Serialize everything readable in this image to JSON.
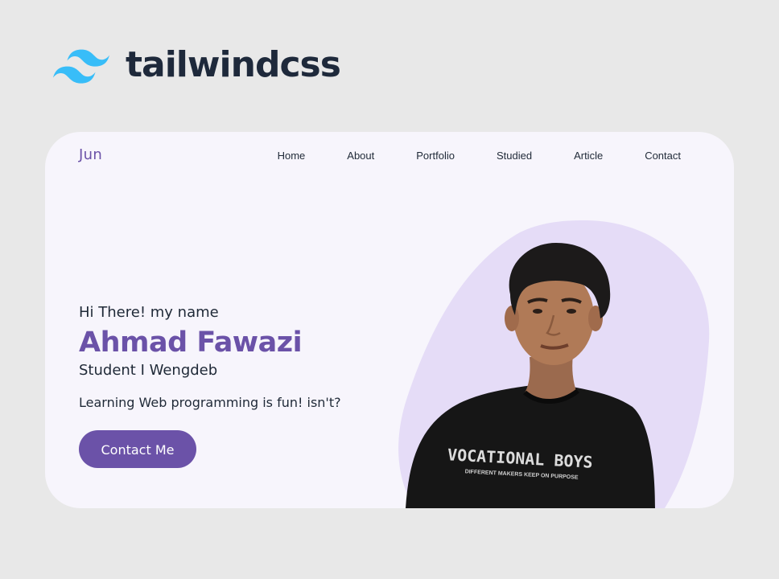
{
  "brand": {
    "logo_text": "tailwindcss",
    "logo_icon": "tailwind-wave-icon",
    "logo_color": "#38bdf8"
  },
  "card": {
    "background": "#f7f5fc",
    "accent": "#6b52a8",
    "blob_color": "#e5dcf7"
  },
  "nav": {
    "logo": "Jun",
    "items": [
      {
        "label": "Home"
      },
      {
        "label": "About"
      },
      {
        "label": "Portfolio"
      },
      {
        "label": "Studied"
      },
      {
        "label": "Article"
      },
      {
        "label": "Contact"
      }
    ]
  },
  "hero": {
    "greeting": "Hi There! my name",
    "name": "Ahmad Fawazi",
    "role": "Student I Wengdeb",
    "tagline": "Learning Web programming is fun! isn't?",
    "cta_label": "Contact Me",
    "shirt_text_1": "VOCATIONAL BOYS",
    "shirt_text_2": "DIFFERENT MAKERS KEEP ON PURPOSE"
  }
}
